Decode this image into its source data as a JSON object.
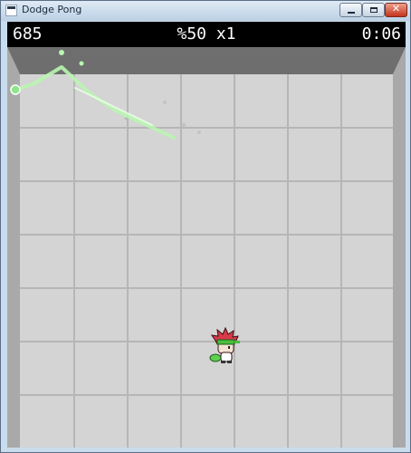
{
  "window": {
    "title": "Dodge Pong",
    "app_icon": "app-icon",
    "controls": {
      "minimize_icon": "minimize-icon",
      "maximize_icon": "maximize-icon",
      "close_glyph": "✕"
    }
  },
  "hud": {
    "score": "685",
    "multiplier": "%50 x1",
    "timer": "0:06"
  },
  "colors": {
    "floor": "#d4d4d4",
    "grid_line": "#b6b6b6",
    "wall": "#8c8c8c",
    "trail": "#b9f5b0",
    "player_hair": "#d93a4a",
    "headband": "#4bbf3f"
  },
  "sprites": {
    "player": "player-character",
    "ball": "ball-green",
    "trail": "ball-trail"
  }
}
